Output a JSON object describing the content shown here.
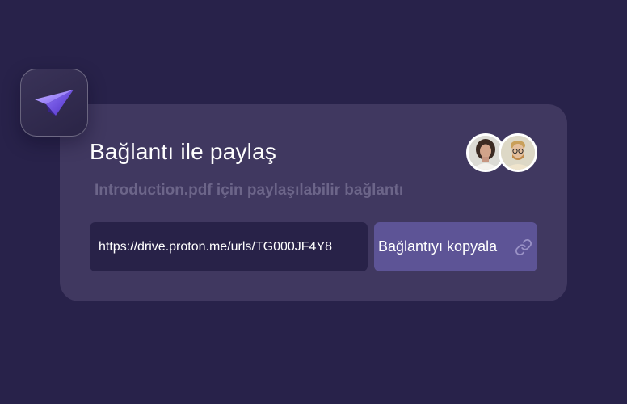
{
  "share": {
    "title": "Bağlantı ile paylaş",
    "subtitle": "Introduction.pdf için paylaşılabilir bağlantı",
    "link_value": "https://drive.proton.me/urls/TG000JF4Y8",
    "copy_button_label": "Bağlantıyı kopyala"
  },
  "colors": {
    "background": "#28224a",
    "card": "#403860",
    "input": "#282248",
    "button": "#5d5496",
    "accent": "#8b7cf6"
  },
  "icons": {
    "app": "paper-plane-icon",
    "copy": "link-icon"
  }
}
